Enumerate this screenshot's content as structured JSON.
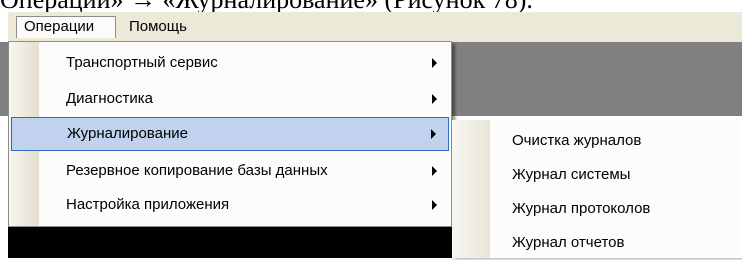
{
  "doc_caption": "Операции» → «Журналирование» (Рисунок 78).",
  "menubar": {
    "items": [
      {
        "label": "Операции"
      },
      {
        "label": "Помощь"
      }
    ]
  },
  "dropdown": {
    "items": [
      {
        "label": "Транспортный сервис",
        "has_submenu": true
      },
      {
        "label": "Диагностика",
        "has_submenu": true
      },
      {
        "label": "Журналирование",
        "has_submenu": true,
        "selected": true
      },
      {
        "label": "Резервное копирование базы данных",
        "has_submenu": true
      },
      {
        "label": "Настройка приложения",
        "has_submenu": true
      }
    ]
  },
  "submenu": {
    "items": [
      {
        "label": "Очистка журналов"
      },
      {
        "label": "Журнал системы"
      },
      {
        "label": "Журнал протоколов"
      },
      {
        "label": "Журнал отчетов"
      }
    ]
  },
  "colors": {
    "menubar_bg": "#ece9d8",
    "highlight_bg": "#c1d2ee",
    "highlight_border": "#316ac5",
    "app_gray": "#808080"
  }
}
